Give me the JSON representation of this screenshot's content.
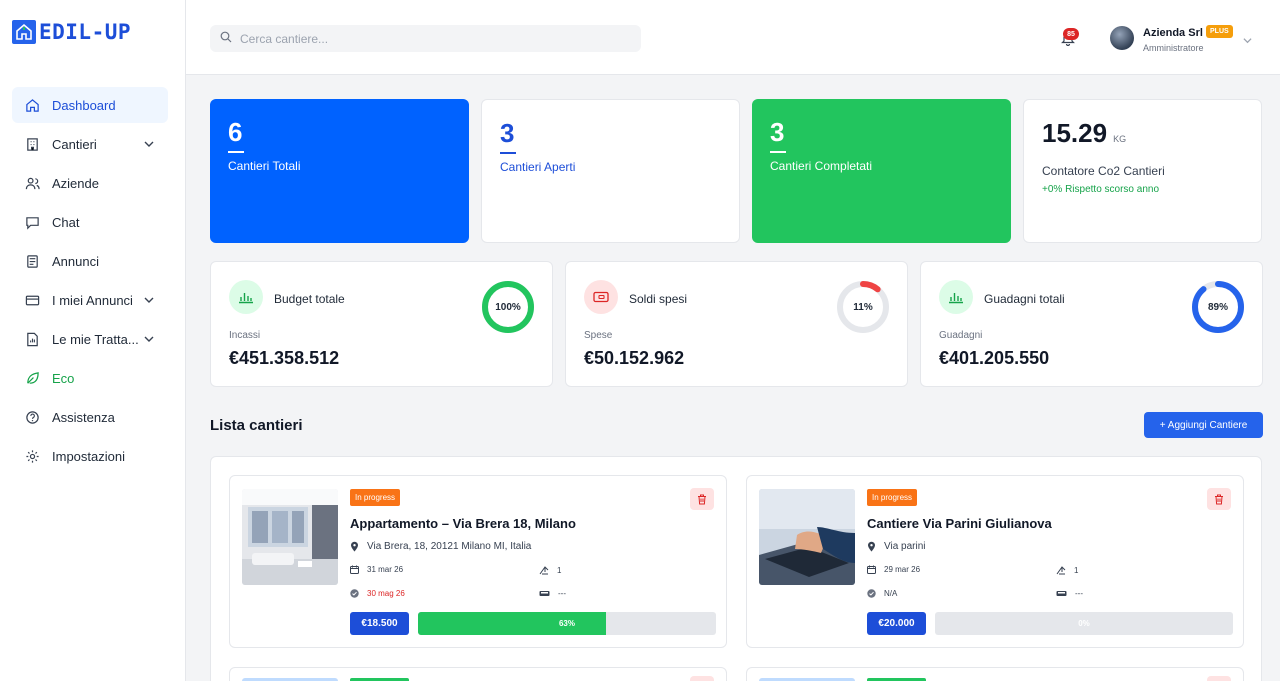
{
  "brand": {
    "name": "EDIL-UP"
  },
  "sidebar": {
    "items": [
      {
        "label": "Dashboard",
        "icon": "home-icon"
      },
      {
        "label": "Cantieri",
        "icon": "building-icon"
      },
      {
        "label": "Aziende",
        "icon": "users-icon"
      },
      {
        "label": "Chat",
        "icon": "chat-icon"
      },
      {
        "label": "Annunci",
        "icon": "newspaper-icon"
      },
      {
        "label": "I miei Annunci",
        "icon": "card-icon"
      },
      {
        "label": "Le mie Tratta...",
        "icon": "document-icon"
      },
      {
        "label": "Eco",
        "icon": "leaf-icon"
      },
      {
        "label": "Assistenza",
        "icon": "help-icon"
      },
      {
        "label": "Impostazioni",
        "icon": "gear-icon"
      }
    ]
  },
  "header": {
    "search_placeholder": "Cerca cantiere...",
    "notifications_count": "85",
    "user_name": "Azienda Srl",
    "user_badge": "PLUS",
    "user_role": "Amministratore"
  },
  "stats": [
    {
      "value": "6",
      "label": "Cantieri Totali"
    },
    {
      "value": "3",
      "label": "Cantieri Aperti"
    },
    {
      "value": "3",
      "label": "Cantieri Completati"
    },
    {
      "value": "15.29",
      "unit": "KG",
      "label": "Contatore Co2 Cantieri",
      "trend": "+0% Rispetto scorso anno"
    }
  ],
  "finance": [
    {
      "title": "Budget totale",
      "sub": "Incassi",
      "value": "€451.358.512",
      "percent_label": "100%",
      "percent": 100,
      "color": "#22c55e",
      "icon": "chart-bars-icon"
    },
    {
      "title": "Soldi spesi",
      "sub": "Spese",
      "value": "€50.152.962",
      "percent_label": "11%",
      "percent": 11,
      "color": "#ef4444",
      "icon": "money-icon"
    },
    {
      "title": "Guadagni totali",
      "sub": "Guadagni",
      "value": "€401.205.550",
      "percent_label": "89%",
      "percent": 89,
      "color": "#2563eb",
      "icon": "chart-bars-icon"
    }
  ],
  "list": {
    "title": "Lista cantieri",
    "add_label": "+ Aggiungi Cantiere"
  },
  "sites": [
    {
      "status": "In progress",
      "name": "Appartamento – Via Brera 18, Milano",
      "address": "Via Brera, 18, 20121 Milano MI, Italia",
      "start_date": "31 mar 26",
      "end_date": "30 mag 26",
      "workers": "1",
      "vehicles": "---",
      "price": "€18.500",
      "progress": 63,
      "progress_label": "63%"
    },
    {
      "status": "In progress",
      "name": "Cantiere Via Parini Giulianova",
      "address": "Via parini",
      "start_date": "29 mar 26",
      "end_date": "N/A",
      "workers": "1",
      "vehicles": "---",
      "price": "€20.000",
      "progress": 0,
      "progress_label": "0%"
    }
  ]
}
